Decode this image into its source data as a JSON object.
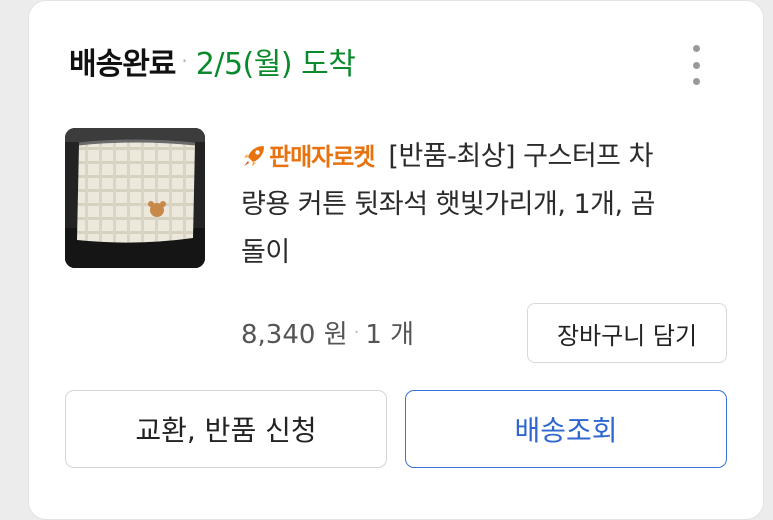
{
  "order": {
    "status": "배송완료",
    "arrival": "2/5(월) 도착"
  },
  "product": {
    "badge": "판매자로켓",
    "title": "[반품-최상] 구스터프 차량용 커튼 뒷좌석 햇빛가리개, 1개, 곰돌이",
    "title_line1": "[반품-최상] 구스터프 차",
    "title_line2": "량용 커튼 뒷좌석 햇빛가리개, 1개, 곰",
    "title_line3": "돌이",
    "price": "8,340 원",
    "quantity": "1 개"
  },
  "buttons": {
    "cart": "장바구니 담기",
    "return": "교환, 반품 신청",
    "track": "배송조회"
  },
  "icons": {
    "more": "more-vertical-icon",
    "rocket": "rocket-icon"
  },
  "colors": {
    "arrival": "#0a8a2c",
    "badge": "#e8730e",
    "track_border": "#3a72d8"
  }
}
